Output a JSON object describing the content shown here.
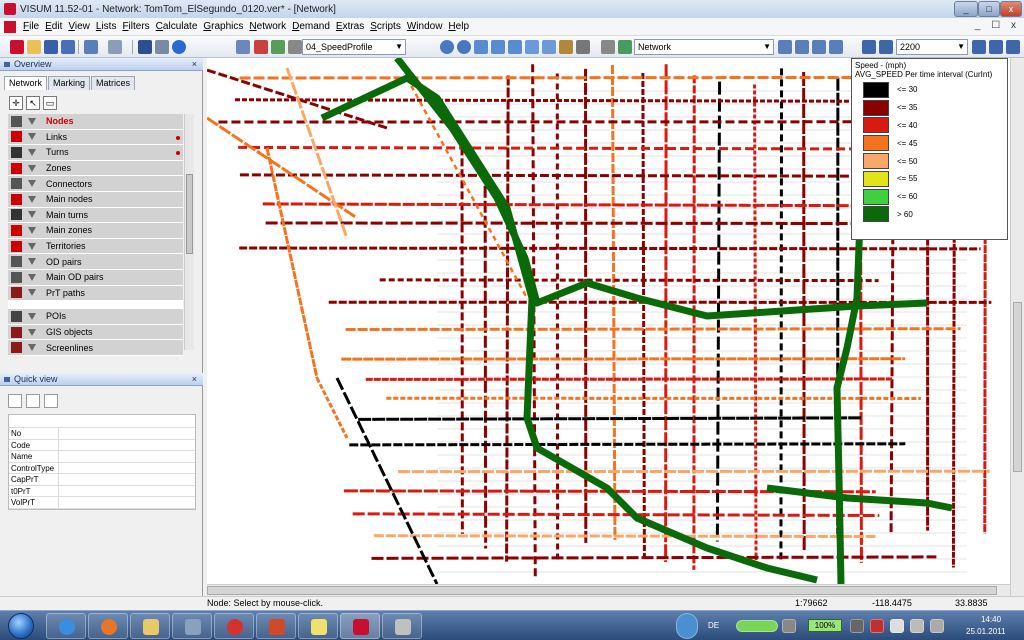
{
  "window": {
    "title": "VISUM 11.52-01 - Network: TomTom_ElSegundo_0120.ver* - [Network]",
    "controls": [
      "_",
      "□",
      "x"
    ],
    "mdi_controls": "_ ☐ x"
  },
  "menu": [
    "File",
    "Edit",
    "View",
    "Lists",
    "Filters",
    "Calculate",
    "Graphics",
    "Network",
    "Demand",
    "Extras",
    "Scripts",
    "Window",
    "Help"
  ],
  "toolbar": {
    "graphic_params": "04_SpeedProfile",
    "mode": "Network",
    "interval": "2200"
  },
  "overview": {
    "header": "Overview",
    "tabs": [
      "Network",
      "Marking",
      "Matrices"
    ],
    "layers": [
      {
        "label": "Nodes",
        "icon": "node-icon",
        "selected": true,
        "dot": false,
        "color": "#555"
      },
      {
        "label": "Links",
        "icon": "link-icon",
        "selected": false,
        "dot": true,
        "color": "#c00"
      },
      {
        "label": "Turns",
        "icon": "turn-icon",
        "selected": false,
        "dot": true,
        "color": "#333"
      },
      {
        "label": "Zones",
        "icon": "zone-icon",
        "selected": false,
        "dot": false,
        "color": "#c00"
      },
      {
        "label": "Connectors",
        "icon": "connector-icon",
        "selected": false,
        "dot": false,
        "color": "#555"
      },
      {
        "label": "Main nodes",
        "icon": "main-node-icon",
        "selected": false,
        "dot": false,
        "color": "#c00"
      },
      {
        "label": "Main turns",
        "icon": "main-turn-icon",
        "selected": false,
        "dot": false,
        "color": "#333"
      },
      {
        "label": "Main zones",
        "icon": "main-zone-icon",
        "selected": false,
        "dot": false,
        "color": "#c00"
      },
      {
        "label": "Territories",
        "icon": "territory-icon",
        "selected": false,
        "dot": false,
        "color": "#c00"
      },
      {
        "label": "OD pairs",
        "icon": "od-pair-icon",
        "selected": false,
        "dot": false,
        "color": "#555"
      },
      {
        "label": "Main OD pairs",
        "icon": "main-od-pair-icon",
        "selected": false,
        "dot": false,
        "color": "#555"
      },
      {
        "label": "PrT paths",
        "icon": "prt-path-icon",
        "selected": false,
        "dot": false,
        "color": "#8b1a1a"
      },
      {
        "label": "POIs",
        "icon": "poi-icon",
        "selected": false,
        "dot": false,
        "color": "#444"
      },
      {
        "label": "GIS objects",
        "icon": "gis-icon",
        "selected": false,
        "dot": false,
        "color": "#8b1a1a"
      },
      {
        "label": "Screenlines",
        "icon": "screenline-icon",
        "selected": false,
        "dot": false,
        "color": "#8b1a1a"
      }
    ]
  },
  "quickview": {
    "header": "Quick view",
    "fields": [
      "No",
      "Code",
      "Name",
      "ControlType",
      "CapPrT",
      "t0PrT",
      "VolPrT"
    ]
  },
  "legend": {
    "title_line1": "Speed - (mph)",
    "title_line2": "AVG_SPEED Per time interval (CurInt)",
    "entries": [
      {
        "label": "<= 30",
        "color": "#000000"
      },
      {
        "label": "<= 35",
        "color": "#8b0000"
      },
      {
        "label": "<= 40",
        "color": "#d81a10"
      },
      {
        "label": "<= 45",
        "color": "#f5731f"
      },
      {
        "label": "<= 50",
        "color": "#f9a86a"
      },
      {
        "label": "<= 55",
        "color": "#e3e31b"
      },
      {
        "label": "<= 60",
        "color": "#3fcf3f"
      },
      {
        "label": "> 60",
        "color": "#0a6a0a"
      }
    ]
  },
  "status": {
    "message": "Node: Select by mouse-click.",
    "scale": "1:79662",
    "x": "-118.4475",
    "y": "33.8835"
  },
  "taskbar": {
    "lang": "DE",
    "battery": "100%",
    "time": "14:40",
    "date": "25.01.2011"
  }
}
